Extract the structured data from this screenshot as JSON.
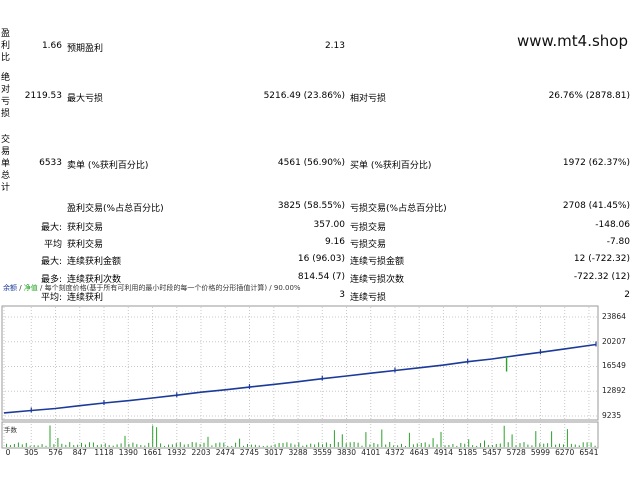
{
  "watermark": "www.mt4.shop",
  "row_labels": {
    "profit_factor": "盈利比",
    "absolute_drawdown": "绝对亏损",
    "total_trades": "交易单总计"
  },
  "rows": {
    "r1": {
      "v1": "1.66",
      "l2": "预期盈利",
      "v2": "2.13"
    },
    "r2": {
      "v1": "2119.53",
      "l2": "最大亏损",
      "v2": "5216.49 (23.86%)",
      "l3": "相对亏损",
      "v3": "26.76% (2878.81)"
    },
    "r3": {
      "v1": "6533",
      "l2": "卖单 (%获利百分比)",
      "v2": "4561 (56.90%)",
      "l3": "买单 (%获利百分比)",
      "v3": "1972 (62.37%)"
    },
    "r4": {
      "l2": "盈利交易(%占总百分比)",
      "v2": "3825 (58.55%)",
      "l3": "亏损交易(%占总百分比)",
      "v3": "2708 (41.45%)"
    },
    "r5": {
      "l1": "最大:",
      "l2": "获利交易",
      "v2": "357.00",
      "l3": "亏损交易",
      "v3": "-148.06"
    },
    "r6": {
      "l1": "平均",
      "l2": "获利交易",
      "v2": "9.16",
      "l3": "亏损交易",
      "v3": "-7.80"
    },
    "r7": {
      "l1": "最大:",
      "l2": "连续获利金额",
      "v2": "16 (96.03)",
      "l3": "连续亏损金额",
      "v3": "12 (-722.32)"
    },
    "r8": {
      "l1": "最多:",
      "l2": "连续获利次数",
      "v2": "814.54 (7)",
      "l3": "连续亏损次数",
      "v3": "-722.32 (12)"
    },
    "r9": {
      "l1": "平均:",
      "l2": "连续获利",
      "v2": "3",
      "l3": "连续亏损",
      "v3": "2"
    }
  },
  "chart_header": {
    "balance": "余额",
    "sep1": " / ",
    "equity": "净值",
    "rest": " / 每个刻度价格(基于所有可利用的最小时段的每一个价格的分形插值计算) / 90.00%"
  },
  "volume_label": "手数",
  "chart_colors": {
    "balance_line": "#1b3a9a",
    "volume_bars": "#2ca02c",
    "equity_spike": "#2ca02c"
  },
  "chart_data": {
    "type": "line",
    "series": [
      {
        "values": [
          [
            0,
            9700
          ],
          [
            305,
            10050
          ],
          [
            576,
            10350
          ],
          [
            847,
            10750
          ],
          [
            1118,
            11150
          ],
          [
            1390,
            11500
          ],
          [
            1661,
            11900
          ],
          [
            1932,
            12300
          ],
          [
            2203,
            12750
          ],
          [
            2474,
            13100
          ],
          [
            2745,
            13500
          ],
          [
            3017,
            13900
          ],
          [
            3288,
            14300
          ],
          [
            3559,
            14750
          ],
          [
            3830,
            15150
          ],
          [
            4101,
            15550
          ],
          [
            4372,
            15950
          ],
          [
            4643,
            16350
          ],
          [
            4914,
            16750
          ],
          [
            5185,
            17250
          ],
          [
            5456,
            17650
          ],
          [
            5728,
            18150
          ],
          [
            5999,
            18650
          ],
          [
            6270,
            19150
          ],
          [
            6541,
            19650
          ],
          [
            6620,
            19800
          ]
        ]
      }
    ],
    "xticks": [
      "0",
      "305",
      "576",
      "847",
      "1118",
      "1390",
      "1661",
      "1932",
      "2203",
      "2474",
      "2745",
      "3017",
      "3288",
      "3559",
      "3830",
      "4101",
      "4372",
      "4643",
      "4914",
      "5185",
      "5457",
      "5728",
      "5999",
      "6270",
      "6541"
    ],
    "yticks": [
      "23864",
      "20207",
      "16549",
      "12892",
      "9235"
    ],
    "ylim": [
      9235,
      24300
    ],
    "equity_drop": {
      "x": 5620,
      "from": 18000,
      "to": 15800
    }
  }
}
